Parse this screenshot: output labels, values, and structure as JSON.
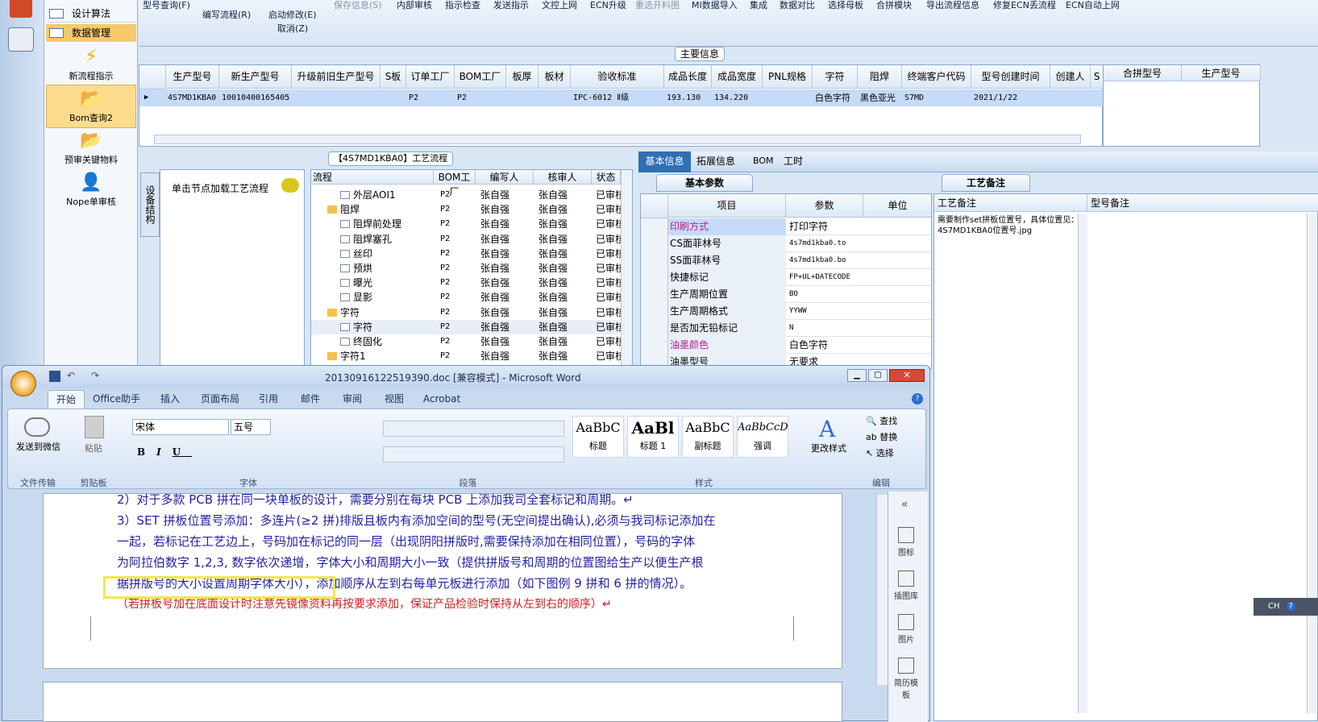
{
  "nav": {
    "items": [
      "设计算法",
      "数据管理"
    ],
    "big": [
      "新流程指示",
      "Bom查询2",
      "预审关键物料",
      "Nope单审核"
    ]
  },
  "toolbar": {
    "row1": [
      "型号查询(F)",
      "保存信息(S)",
      "内部审核",
      "指示检查",
      "发送指示",
      "文控上网",
      "ECN升级",
      "重选开料图",
      "MI数据导入",
      "集成",
      "数据对比",
      "选择母板",
      "合拼模块",
      "导出流程信息",
      "修复ECN丢流程",
      "ECN自动上网"
    ],
    "row2": [
      "编写流程(R)",
      "启动修改(E)",
      "取消(Z)"
    ]
  },
  "main": {
    "title": "主要信息",
    "headers": [
      "生产型号",
      "新生产型号",
      "升级前旧生产型号",
      "S板",
      "订单工厂",
      "BOM工厂",
      "板厚",
      "板材",
      "验收标准",
      "成品长度",
      "成品宽度",
      "PNL规格",
      "字符",
      "阻焊",
      "终端客户代码",
      "型号创建时间",
      "创建人",
      "S"
    ],
    "row": [
      "4S7MD1KBA0",
      "10010400165405",
      "",
      "",
      "P2",
      "P2",
      "",
      "",
      "IPC-6012 Ⅱ级",
      "193.130",
      "134.220",
      "",
      "白色字符",
      "黑色亚光",
      "S7MD",
      "2021/1/22",
      "",
      ""
    ],
    "right_headers": [
      "合拼型号",
      "生产型号"
    ]
  },
  "flow": {
    "title": "【4S7MD1KBA0】工艺流程",
    "vtab": "设备结构",
    "hint": "单击节点加载工艺流程",
    "headers": [
      "流程",
      "BOM工厂",
      "编写人",
      "核审人",
      "状态"
    ],
    "rows": [
      [
        "外层AOI1",
        "P2",
        "张自强",
        "张自强",
        "已审核"
      ],
      [
        "阻焊",
        "P2",
        "张自强",
        "张自强",
        "已审核"
      ],
      [
        "阻焊前处理",
        "P2",
        "张自强",
        "张自强",
        "已审核"
      ],
      [
        "阻焊塞孔",
        "P2",
        "张自强",
        "张自强",
        "已审核"
      ],
      [
        "丝印",
        "P2",
        "张自强",
        "张自强",
        "已审核"
      ],
      [
        "预烘",
        "P2",
        "张自强",
        "张自强",
        "已审核"
      ],
      [
        "曝光",
        "P2",
        "张自强",
        "张自强",
        "已审核"
      ],
      [
        "显影",
        "P2",
        "张自强",
        "张自强",
        "已审核"
      ],
      [
        "字符",
        "P2",
        "张自强",
        "张自强",
        "已审核"
      ],
      [
        "字符",
        "P2",
        "张自强",
        "张自强",
        "已审核"
      ],
      [
        "终固化",
        "P2",
        "张自强",
        "张自强",
        "已审核"
      ],
      [
        "字符1",
        "P2",
        "张自强",
        "张自强",
        "已审核"
      ]
    ]
  },
  "tabs": [
    "基本信息",
    "拓展信息",
    "BOM",
    "工时"
  ],
  "params": {
    "tab": "基本参数",
    "headers": [
      "项目",
      "参数",
      "单位"
    ],
    "rows": [
      [
        "印刷方式",
        "打印字符"
      ],
      [
        "CS面菲林号",
        "4s7md1kba0.to"
      ],
      [
        "SS面菲林号",
        "4s7md1kba0.bo"
      ],
      [
        "快捷标记",
        "FP+UL+DATECODE"
      ],
      [
        "生产周期位置",
        "BO"
      ],
      [
        "生产周期格式",
        "YYWW"
      ],
      [
        "是否加无铅标记",
        "N"
      ],
      [
        "油墨颜色",
        "白色字符"
      ],
      [
        "油墨型号",
        "无要求"
      ]
    ]
  },
  "remarks": {
    "tab": "工艺备注",
    "col1": "工艺备注",
    "col2": "型号备注",
    "text": "需要制作set拼板位置号，具体位置见：4S7MD1KBA0位置号.jpg"
  },
  "word": {
    "title": "20130916122519390.doc [兼容模式] - Microsoft Word",
    "tabs": [
      "开始",
      "Office助手",
      "插入",
      "页面布局",
      "引用",
      "邮件",
      "审阅",
      "视图",
      "Acrobat"
    ],
    "font": "宋体",
    "size": "五号",
    "groups": [
      "文件传输",
      "剪贴板",
      "字体",
      "段落",
      "样式",
      "编辑"
    ],
    "send": "发送到微信",
    "paste": "粘贴",
    "styles": [
      [
        "AaBbC",
        "标题"
      ],
      [
        "AaBl",
        "标题 1"
      ],
      [
        "AaBbC",
        "副标题"
      ],
      [
        "AaBbCcD",
        "强调"
      ]
    ],
    "change_styles": "更改样式",
    "edit": [
      "查找",
      "替换",
      "选择"
    ],
    "lines": [
      "2）对于多款 PCB 拼在同一块单板的设计，需要分别在每块 PCB 上添加我司全套标记和周期。↵",
      "3）SET 拼板位置号添加：多连片(≥2 拼)排版且板内有添加空间的型号(无空间提出确认),必须与我司标记添加在",
      "一起，若标记在工艺边上，号码加在标记的同一层（出现阴阳拼版时,需要保持添加在相同位置），号码的字体",
      "为阿拉伯数字 1,2,3, 数字依次递增，字体大小和周期大小一致（提供拼版号和周期的位置图给生产以便生产根",
      "据拼版号的大小设置周期字体大小），添加顺序从左到右每单元板进行添加（如下图例 9 拼和 6 拼的情况）。",
      "（若拼板号加在底面设计时注意先镜像资料再按要求添加，保证产品检验时保持从左到右的顺序）↵"
    ],
    "side": [
      "图标",
      "插图库",
      "图片",
      "简历模板"
    ],
    "ime": "CH"
  }
}
